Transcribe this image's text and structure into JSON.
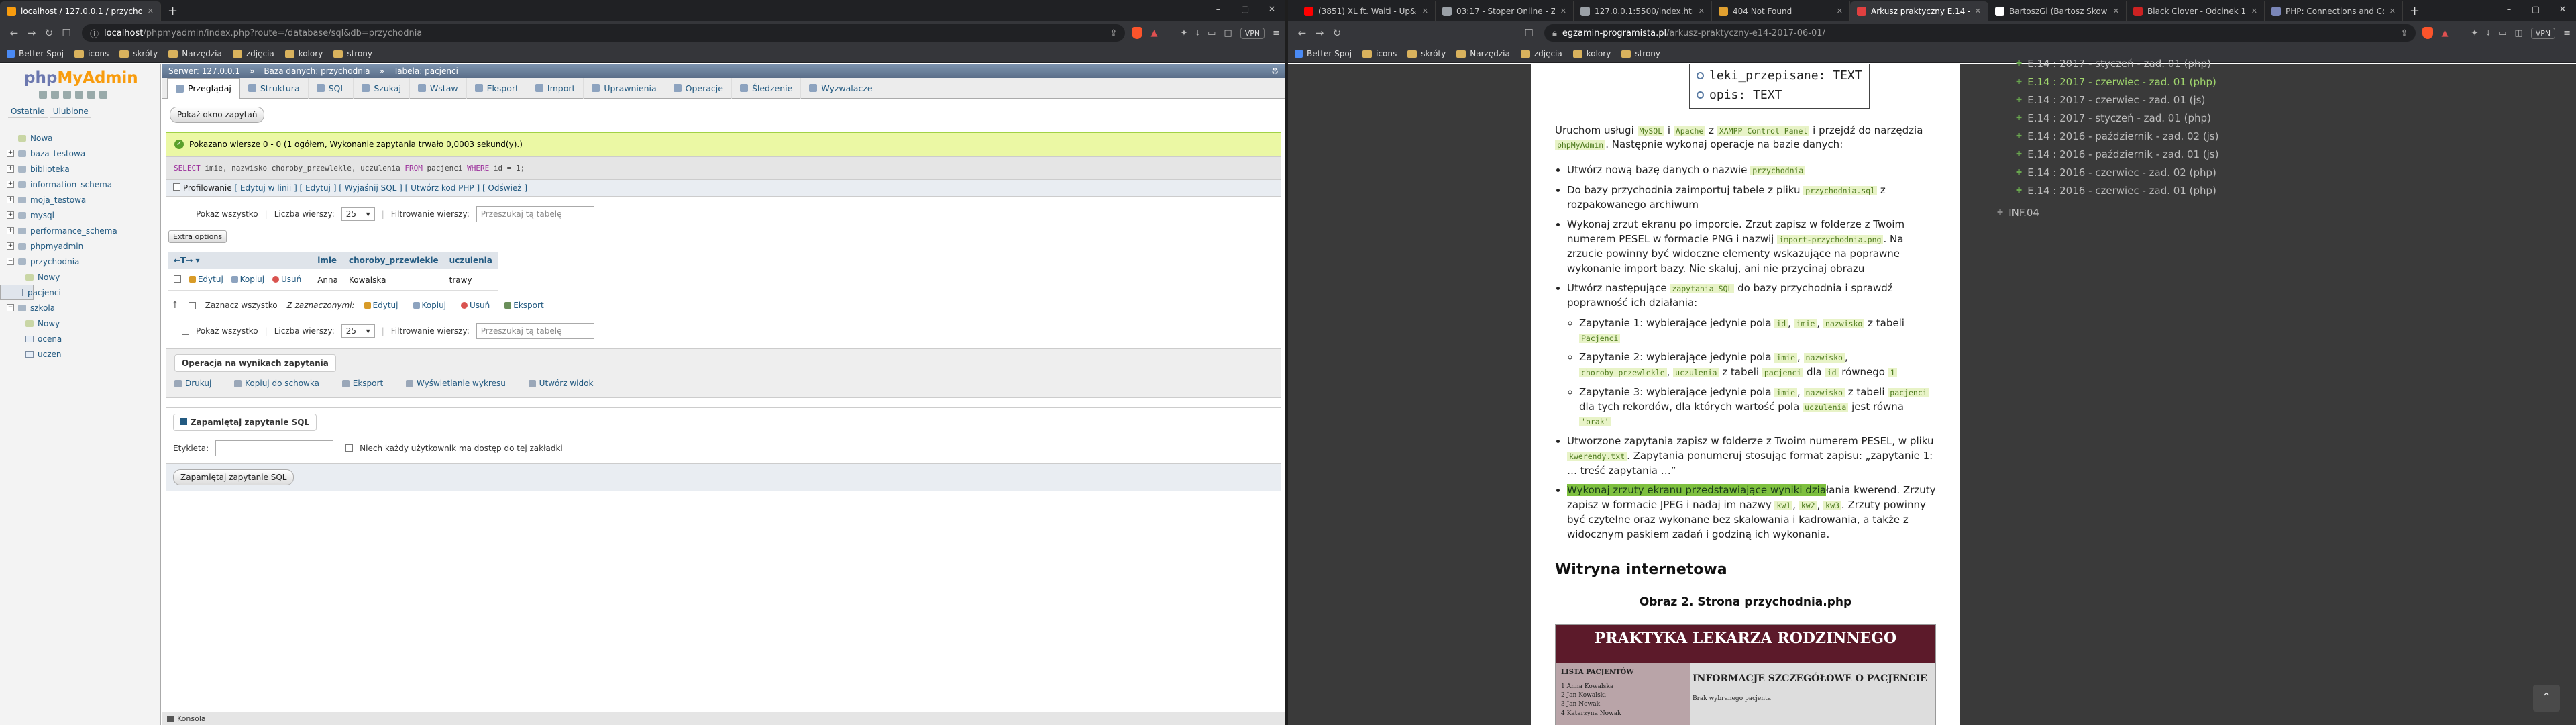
{
  "left_browser": {
    "tabs": [
      {
        "label": "localhost / 127.0.0.1 / przychodnia",
        "active": true,
        "color": "#f89c0e"
      }
    ],
    "newtab": "+",
    "address": {
      "host": "localhost",
      "path": "/phpmyadmin/index.php?route=/database/sql&db=przychodnia"
    },
    "vpn": "VPN",
    "bookmarks": [
      "Better Spoj",
      "icons",
      "skróty",
      "Narzędzia",
      "zdjęcia",
      "kolory",
      "strony"
    ]
  },
  "pma": {
    "logo_a": "php",
    "logo_b": "MyAdmin",
    "nav_tabs": [
      "Ostatnie",
      "Ulubione"
    ],
    "tree": [
      {
        "label": "Nowa",
        "level": 0,
        "type": "new"
      },
      {
        "label": "baza_testowa",
        "level": 0,
        "type": "db"
      },
      {
        "label": "biblioteka",
        "level": 0,
        "type": "db"
      },
      {
        "label": "information_schema",
        "level": 0,
        "type": "db"
      },
      {
        "label": "moja_testowa",
        "level": 0,
        "type": "db"
      },
      {
        "label": "mysql",
        "level": 0,
        "type": "db"
      },
      {
        "label": "performance_schema",
        "level": 0,
        "type": "db"
      },
      {
        "label": "phpmyadmin",
        "level": 0,
        "type": "db"
      },
      {
        "label": "przychodnia",
        "level": 0,
        "type": "db",
        "open": true
      },
      {
        "label": "Nowy",
        "level": 1,
        "type": "new"
      },
      {
        "label": "pacjenci",
        "level": 1,
        "type": "table",
        "selected": true
      },
      {
        "label": "szkola",
        "level": 0,
        "type": "db",
        "open": true
      },
      {
        "label": "Nowy",
        "level": 1,
        "type": "new"
      },
      {
        "label": "ocena",
        "level": 1,
        "type": "table"
      },
      {
        "label": "uczen",
        "level": 1,
        "type": "table"
      }
    ],
    "breadcrumb": [
      "Serwer: 127.0.0.1",
      "Baza danych: przychodnia",
      "Tabela: pacjenci"
    ],
    "tabs": [
      "Przeglądaj",
      "Struktura",
      "SQL",
      "Szukaj",
      "Wstaw",
      "Eksport",
      "Import",
      "Uprawnienia",
      "Operacje",
      "Śledzenie",
      "Wyzwalacze"
    ],
    "active_tab": 0,
    "query_window_btn": "Pokaż okno zapytań",
    "success": "Pokazano wiersze 0 - 0 (1 ogółem, Wykonanie zapytania trwało 0,0003 sekund(y).)",
    "sql": {
      "k1": "SELECT",
      "cols": " imie, nazwisko choroby_przewlekle, uczulenia ",
      "k2": "FROM",
      "tbl": " pacjenci ",
      "k3": "WHERE",
      "cond": " id = 1;"
    },
    "profiling": "Profilowanie",
    "profiling_links": "[ Edytuj w linii ] [ Edytuj ] [ Wyjaśnij SQL ] [ Utwórz kod PHP ] [ Odśwież ]",
    "show_all": "Pokaż wszystko",
    "rows_label": "Liczba wierszy:",
    "rows_value": "25",
    "filter_label": "Filtrowanie wierszy:",
    "filter_placeholder": "Przeszukaj tą tabelę",
    "extra_options": "Extra options",
    "columns": [
      "imie",
      "choroby_przewlekle",
      "uczulenia"
    ],
    "row": {
      "actions": [
        "Edytuj",
        "Kopiuj",
        "Usuń"
      ],
      "values": [
        "Anna",
        "Kowalska",
        "trawy"
      ]
    },
    "check_all": "Zaznacz wszystko",
    "with_selected": "Z zaznaczonymi:",
    "bulk_actions": [
      "Edytuj",
      "Kopiuj",
      "Usuń",
      "Eksport"
    ],
    "ops_title": "Operacja na wynikach zapytania",
    "ops": [
      "Drukuj",
      "Kopiuj do schowka",
      "Eksport",
      "Wyświetlanie wykresu",
      "Utwórz widok"
    ],
    "bookmark_title": "Zapamiętaj zapytanie SQL",
    "label_field": "Etykieta:",
    "share_label": "Niech każdy użytkownik ma dostęp do tej zakładki",
    "bookmark_btn": "Zapamiętaj zapytanie SQL",
    "console": "Konsola"
  },
  "right_browser": {
    "tabs": [
      {
        "label": "(3851) XL ft. Waiti - Up&D...",
        "color": "#ff0000"
      },
      {
        "label": "03:17 - Stoper Online - ZegarO...",
        "color": "#9aa0a6"
      },
      {
        "label": "127.0.0.1:5500/index.html",
        "color": "#9aa0a6"
      },
      {
        "label": "404 Not Found",
        "color": "#e0a030"
      },
      {
        "label": "Arkusz praktyczny E.14 - 20...",
        "color": "#e04040",
        "active": true
      },
      {
        "label": "BartoszGi (Bartosz Skowrycki)",
        "color": "#ffffff"
      },
      {
        "label": "Black Clover - Odcinek 170 Na...",
        "color": "#cc2222"
      },
      {
        "label": "PHP: Connections and Conne...",
        "color": "#7a86b8"
      }
    ],
    "newtab": "+",
    "address": {
      "host": "egzamin-programista.pl",
      "path": "/arkusz-praktyczny-e14-2017-06-01/"
    },
    "vpn": "VPN",
    "bookmarks": [
      "Better Spoj",
      "icons",
      "skróty",
      "Narzędzia",
      "zdjęcia",
      "kolory",
      "strony"
    ]
  },
  "article": {
    "table_fields": [
      "leki_przepisane: TEXT",
      "opis: TEXT"
    ],
    "intro_a": "Uruchom usługi ",
    "intro_c1": "MySQL",
    "intro_b": " i ",
    "intro_c2": "Apache",
    "intro_z": " z ",
    "intro_c3": "XAMPP Control Panel",
    "intro_d": " i przejdź do narzędzia ",
    "intro_c4": "phpMyAdmin",
    "intro_e": ". Następnie wykonaj operacje na bazie danych:",
    "b1a": "Utwórz nową bazę danych o nazwie ",
    "b1c": "przychodnia",
    "b2a": "Do bazy przychodnia zaimportuj tabele z pliku ",
    "b2c": "przychodnia.sql",
    "b2b": " z rozpakowanego archiwum",
    "b3a": "Wykonaj zrzut ekranu po imporcie. Zrzut zapisz w folderze z Twoim numerem PESEL w formacie PNG i nazwij ",
    "b3c": "import-przychodnia.png",
    "b3b": ". Na zrzucie powinny być widoczne elementy wskazujące na poprawne wykonanie import bazy. Nie skaluj, ani nie przycinaj obrazu",
    "b4a": "Utwórz następujące ",
    "b4c": "zapytania SQL",
    "b4b": " do bazy przychodnia i sprawdź poprawność ich działania:",
    "q1a": "Zapytanie 1: wybierające jedynie pola ",
    "q1c1": "id",
    "q1c2": "imie",
    "q1c3": "nazwisko",
    "q1b": " z tabeli ",
    "q1c4": "Pacjenci",
    "q2a": "Zapytanie 2: wybierające jedynie pola ",
    "q2c1": "imie",
    "q2c2": "nazwisko",
    "q2c3": "choroby_przewlekle",
    "q2c4": "uczulenia",
    "q2b": " z tabeli ",
    "q2c5": "pacjenci",
    "q2d": " dla ",
    "q2c6": "id",
    "q2e": " równego ",
    "q2c7": "1",
    "q3a": "Zapytanie 3: wybierające jedynie pola ",
    "q3c1": "imie",
    "q3c2": "nazwisko",
    "q3b": " z tabeli ",
    "q3c3": "pacjenci",
    "q3d": " dla tych rekordów, dla których wartość pola ",
    "q3c4": "uczulenia",
    "q3e": " jest równa ",
    "q3c5": "'brak'",
    "b5a": "Utworzone zapytania zapisz w folderze z Twoim numerem PESEL, w pliku ",
    "b5c": "kwerendy.txt",
    "b5b": ". Zapytania ponumeruj stosując format zapisu: „zapytanie 1: … treść zapytania …”",
    "b6hl": "Wykonaj zrzuty ekranu przedstawiające wyniki dzia",
    "b6a": "łania kwerend. Zrzuty zapisz w formacie JPEG i nadaj im nazwy ",
    "b6c1": "kw1",
    "b6c2": "kw2",
    "b6c3": "kw3",
    "b6b": ". Zrzuty powinny być czytelne oraz wykonane bez skalowania i kadrowania, a także z widocznym paskiem zadań i godziną ich wykonania.",
    "section": "Witryna internetowa",
    "figure": "Obraz 2. Strona przychodnia.php",
    "shot_title": "PRAKTYKA LEKARZA RODZINNEGO",
    "shot_left_title": "LISTA PACJENTÓW",
    "shot_left_items": [
      "1 Anna Kowalska",
      "2 Jan Kowalski",
      "3 Jan Nowak",
      "4 Katarzyna Nowak"
    ],
    "shot_right_title": "INFORMACJE SZCZEGÓŁOWE O PACJENCIE",
    "shot_right_text": "Brak wybranego pacjenta"
  },
  "sidebar": {
    "items": [
      {
        "label": "E.14 : 2017 - styczeń - zad. 01 (php)"
      },
      {
        "label": "E.14 : 2017 - czerwiec - zad. 01 (php)",
        "current": true
      },
      {
        "label": "E.14 : 2017 - czerwiec - zad. 01 (js)"
      },
      {
        "label": "E.14 : 2017 - styczeń - zad. 01 (php)"
      },
      {
        "label": "E.14 : 2016 - październik - zad. 02 (js)"
      },
      {
        "label": "E.14 : 2016 - październik - zad. 01 (js)"
      },
      {
        "label": "E.14 : 2016 - czerwiec - zad. 02 (php)"
      },
      {
        "label": "E.14 : 2016 - czerwiec - zad. 01 (php)"
      }
    ],
    "section": "INF.04"
  },
  "colors": {
    "pma_link": "#235a81",
    "success_bg": "#ebf8a4",
    "code_bg": "#e8f3c7",
    "code_fg": "#4d7a1d",
    "highlight": "#7ec03f",
    "sidebar_current": "#9fd46c"
  }
}
